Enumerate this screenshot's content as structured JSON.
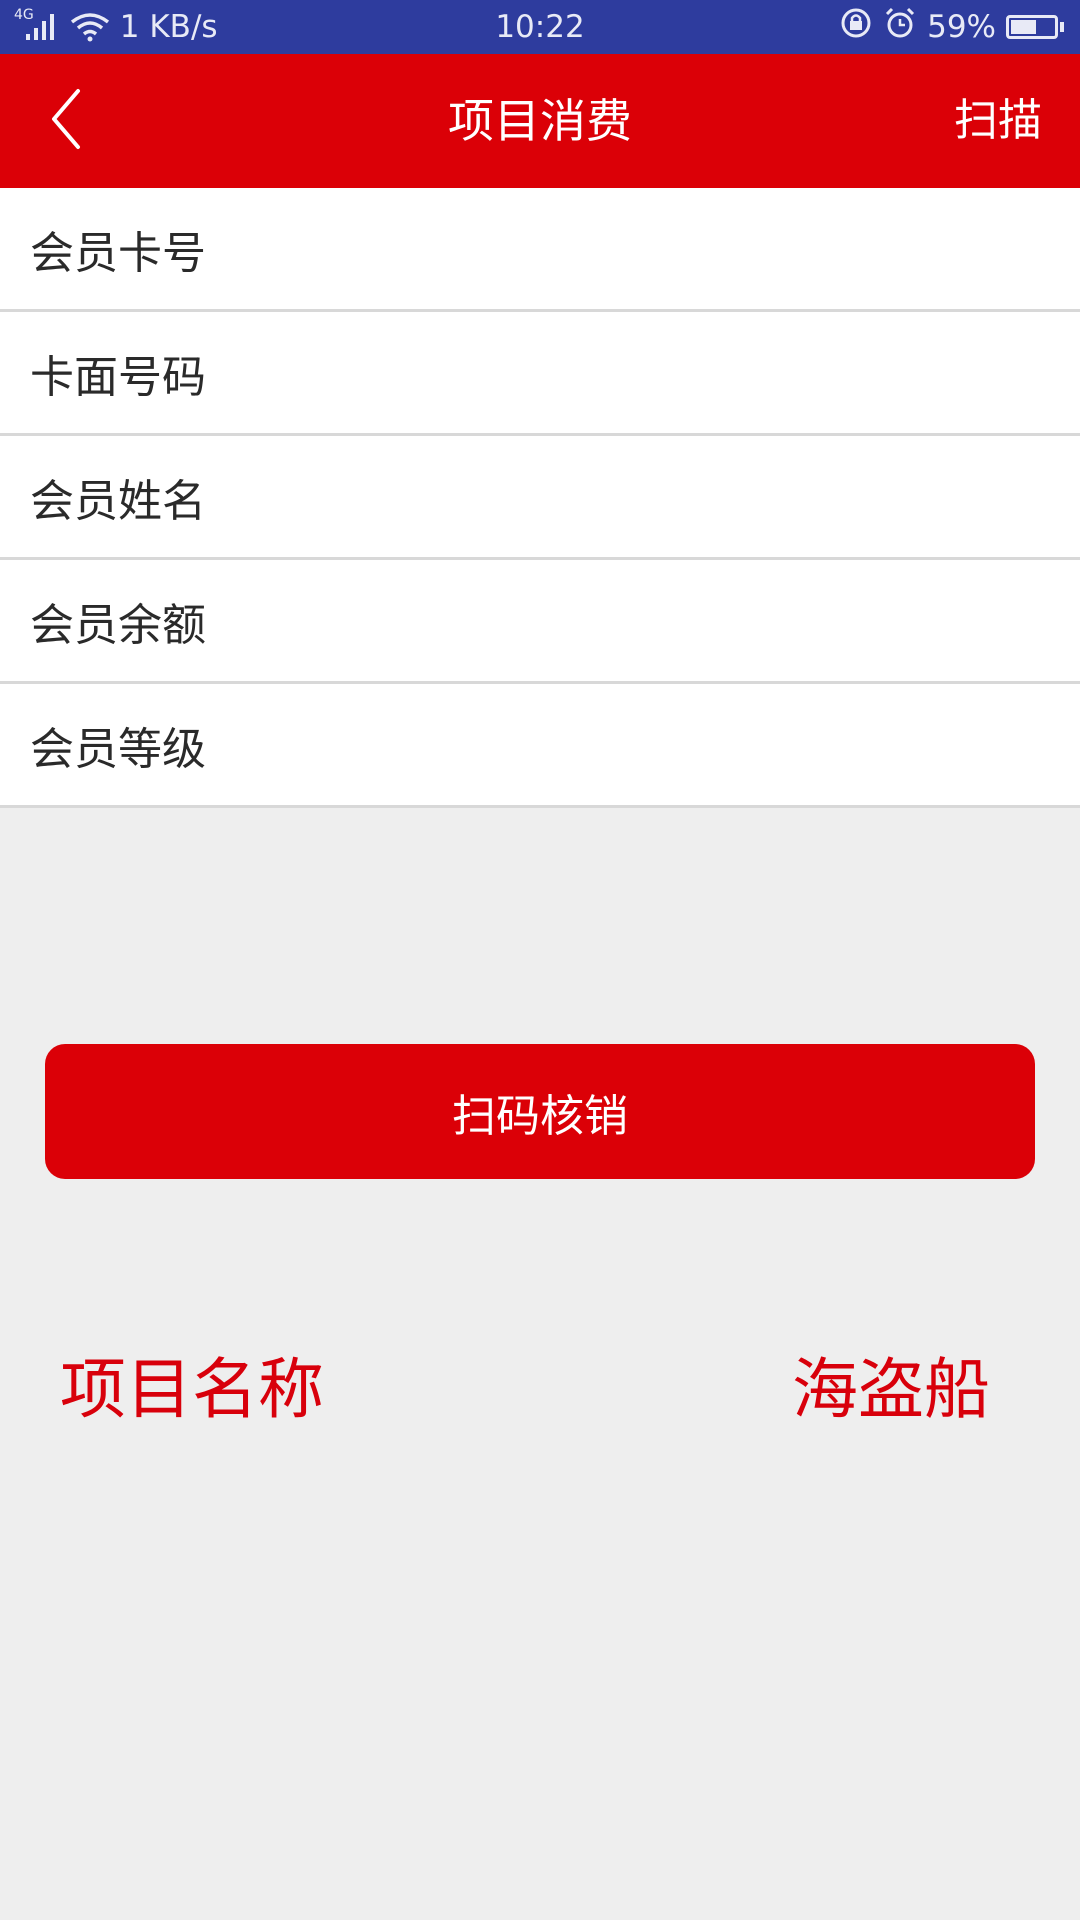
{
  "status_bar": {
    "network_type": "4G",
    "speed": "1 KB/s",
    "time": "10:22",
    "battery_text": "59%",
    "battery_level": 0.59,
    "icons": [
      "signal-icon",
      "wifi-icon",
      "rotation-lock-icon",
      "alarm-icon",
      "battery-icon"
    ]
  },
  "header": {
    "title": "项目消费",
    "scan_label": "扫描",
    "back_icon": "chevron-left-icon"
  },
  "form": {
    "rows": [
      {
        "label": "会员卡号",
        "value": ""
      },
      {
        "label": "卡面号码",
        "value": ""
      },
      {
        "label": "会员姓名",
        "value": ""
      },
      {
        "label": "会员余额",
        "value": ""
      },
      {
        "label": "会员等级",
        "value": ""
      }
    ]
  },
  "actions": {
    "scan_verify_label": "扫码核销"
  },
  "project": {
    "label": "项目名称",
    "value": "海盗船"
  },
  "colors": {
    "status_bar": "#2e3c9e",
    "brand_red": "#db0007",
    "background": "#eeeeee"
  }
}
